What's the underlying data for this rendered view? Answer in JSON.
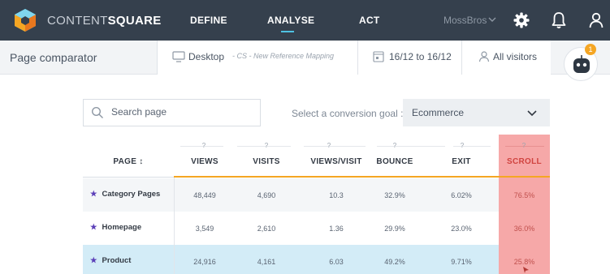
{
  "topbar": {
    "brand_light": "CONTENT",
    "brand_bold": "SQUARE",
    "nav": [
      "DEFINE",
      "ANALYSE",
      "ACT"
    ],
    "account": "MossBros",
    "icons": [
      "settings-gear-icon",
      "notification-bell-icon",
      "user-icon"
    ],
    "colors": {
      "bar": "#35404d",
      "active_underline": "#4fc3e3",
      "logo_orange": "#f5a623",
      "logo_blue": "#4fc3e3"
    }
  },
  "subbar": {
    "title": "Page comparator",
    "device": "Desktop",
    "mapping": "- CS - New Reference Mapping",
    "date_from": "16/12",
    "date_to_sep": "to",
    "date_to": "16/12",
    "segment": "All visitors",
    "bot_badge": "1"
  },
  "search": {
    "placeholder": "Search page"
  },
  "goal": {
    "label": "Select a conversion goal :",
    "value": "Ecommerce"
  },
  "table": {
    "help_mark": "?",
    "columns": [
      "PAGE ↕",
      "VIEWS",
      "VISITS",
      "VIEWS/VISIT",
      "BOUNCE",
      "EXIT",
      "SCROLL"
    ],
    "highlight_color": "#f6a8a8",
    "rows": [
      {
        "page": "Category Pages",
        "views": "48,449",
        "visits": "4,690",
        "views_visit": "10.3",
        "bounce": "32.9%",
        "exit": "6.02%",
        "scroll": "76.5%"
      },
      {
        "page": "Homepage",
        "views": "3,549",
        "visits": "2,610",
        "views_visit": "1.36",
        "bounce": "29.9%",
        "exit": "23.0%",
        "scroll": "36.0%"
      },
      {
        "page": "Product",
        "views": "24,916",
        "visits": "4,161",
        "views_visit": "6.03",
        "bounce": "49.2%",
        "exit": "9.71%",
        "scroll": "25.8%"
      }
    ]
  }
}
